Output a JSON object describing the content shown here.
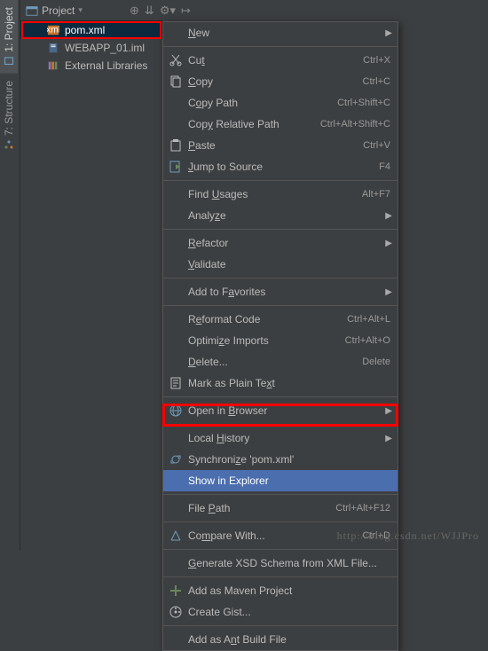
{
  "leftTabs": [
    {
      "label": "1: Project",
      "active": true
    },
    {
      "label": "7: Structure",
      "active": false
    }
  ],
  "projectHeader": {
    "title": "Project"
  },
  "tree": {
    "items": [
      {
        "label": "pom.xml",
        "selected": true,
        "icon": "xml"
      },
      {
        "label": "WEBAPP_01.iml",
        "selected": false,
        "icon": "iml"
      },
      {
        "label": "External Libraries",
        "selected": false,
        "icon": "lib"
      }
    ]
  },
  "menu": [
    {
      "type": "item",
      "labelHtml": "<u>N</u>ew",
      "arrow": true
    },
    {
      "type": "sep"
    },
    {
      "type": "item",
      "icon": "cut",
      "labelHtml": "Cu<u>t</u>",
      "shortcut": "Ctrl+X"
    },
    {
      "type": "item",
      "icon": "copy",
      "labelHtml": "<u>C</u>opy",
      "shortcut": "Ctrl+C"
    },
    {
      "type": "item",
      "labelHtml": "C<u>o</u>py Path",
      "shortcut": "Ctrl+Shift+C"
    },
    {
      "type": "item",
      "labelHtml": "Cop<u>y</u> Relative Path",
      "shortcut": "Ctrl+Alt+Shift+C"
    },
    {
      "type": "item",
      "icon": "paste",
      "labelHtml": "<u>P</u>aste",
      "shortcut": "Ctrl+V"
    },
    {
      "type": "item",
      "icon": "jump",
      "labelHtml": "<u>J</u>ump to Source",
      "shortcut": "F4"
    },
    {
      "type": "sep"
    },
    {
      "type": "item",
      "labelHtml": "Find <u>U</u>sages",
      "shortcut": "Alt+F7"
    },
    {
      "type": "item",
      "labelHtml": "Analy<u>z</u>e",
      "arrow": true
    },
    {
      "type": "sep"
    },
    {
      "type": "item",
      "labelHtml": "<u>R</u>efactor",
      "arrow": true
    },
    {
      "type": "item",
      "labelHtml": "<u>V</u>alidate"
    },
    {
      "type": "sep"
    },
    {
      "type": "item",
      "labelHtml": "Add to F<u>a</u>vorites",
      "arrow": true
    },
    {
      "type": "sep"
    },
    {
      "type": "item",
      "labelHtml": "R<u>e</u>format Code",
      "shortcut": "Ctrl+Alt+L"
    },
    {
      "type": "item",
      "labelHtml": "Optimi<u>z</u>e Imports",
      "shortcut": "Ctrl+Alt+O"
    },
    {
      "type": "item",
      "labelHtml": "<u>D</u>elete...",
      "shortcut": "Delete"
    },
    {
      "type": "item",
      "icon": "text",
      "labelHtml": "Mark as Plain Te<u>x</u>t"
    },
    {
      "type": "sep"
    },
    {
      "type": "item",
      "icon": "browser",
      "labelHtml": "Open in <u>B</u>rowser",
      "arrow": true
    },
    {
      "type": "sep"
    },
    {
      "type": "item",
      "labelHtml": "Local <u>H</u>istory",
      "arrow": true
    },
    {
      "type": "item",
      "icon": "sync",
      "labelHtml": "Synchroni<u>z</u>e 'pom.xml'"
    },
    {
      "type": "item",
      "labelHtml": "Show in Explorer",
      "highlight": true
    },
    {
      "type": "sep"
    },
    {
      "type": "item",
      "labelHtml": "File <u>P</u>ath",
      "shortcut": "Ctrl+Alt+F12"
    },
    {
      "type": "sep"
    },
    {
      "type": "item",
      "icon": "compare",
      "labelHtml": "Co<u>m</u>pare With...",
      "shortcut": "Ctrl+D"
    },
    {
      "type": "sep"
    },
    {
      "type": "item",
      "labelHtml": "<u>G</u>enerate XSD Schema from XML File..."
    },
    {
      "type": "sep"
    },
    {
      "type": "item",
      "icon": "maven",
      "labelHtml": "Add as Maven Project"
    },
    {
      "type": "item",
      "icon": "gist",
      "labelHtml": "Create Gist..."
    },
    {
      "type": "sep"
    },
    {
      "type": "item",
      "labelHtml": "Add as A<u>n</u>t Build File"
    }
  ],
  "watermark": "http://blog.csdn.net/WJJPro"
}
